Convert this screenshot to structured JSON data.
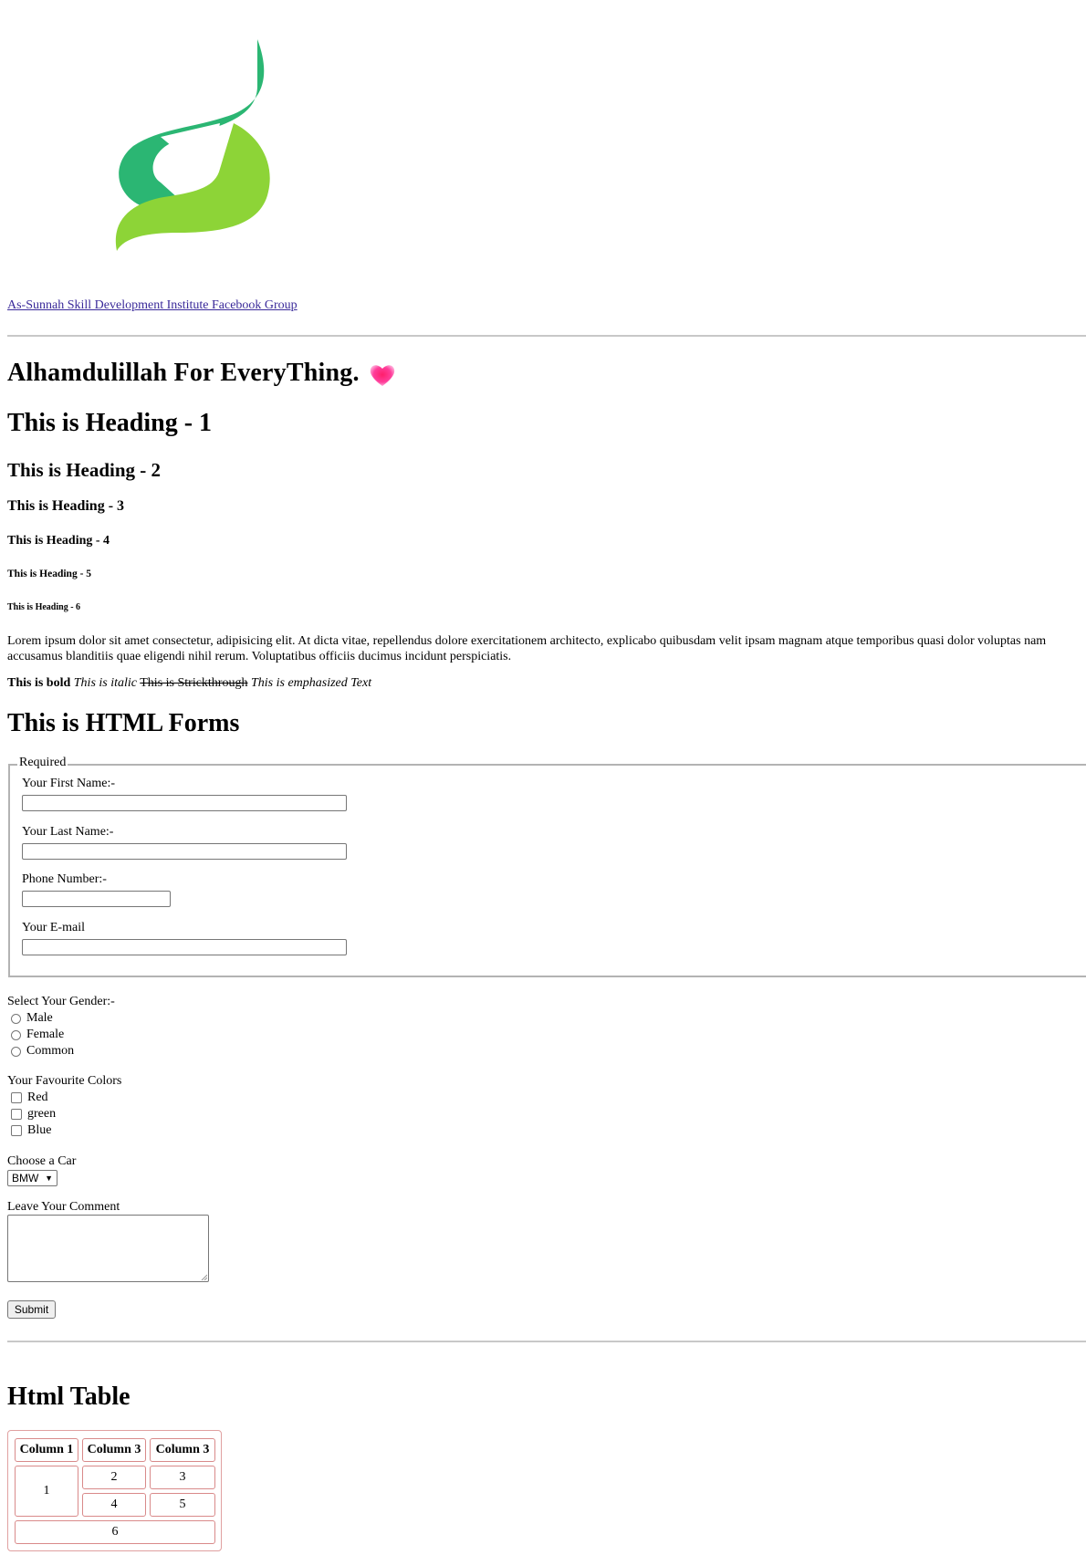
{
  "link": {
    "text": "As-Sunnah Skill Development Institute Facebook Group"
  },
  "headings": {
    "main": "Alhamdulillah For EveryThing.",
    "h1": "This is Heading - 1",
    "h2": "This is Heading - 2",
    "h3": "This is Heading - 3",
    "h4": "This is Heading - 4",
    "h5": "This is Heading - 5",
    "h6": "This is Heading - 6"
  },
  "paragraph": "Lorem ipsum dolor sit amet consectetur, adipisicing elit. At dicta vitae, repellendus dolore exercitationem architecto, explicabo quibusdam velit ipsam magnam atque temporibus quasi dolor voluptas nam accusamus blanditiis quae eligendi nihil rerum. Voluptatibus officiis ducimus incidunt perspiciatis.",
  "formatting": {
    "bold": "This is bold",
    "italic": "This is italic",
    "strike": "This is Strickthrough",
    "emphasized": "This is emphasized Text"
  },
  "forms": {
    "title": "This is HTML Forms",
    "legend": "Required",
    "first_name_label": "Your First Name:-",
    "first_name_value": "",
    "last_name_label": "Your Last Name:-",
    "last_name_value": "",
    "phone_label": "Phone Number:-",
    "phone_value": "",
    "email_label": "Your E-mail",
    "email_value": "",
    "gender_label": "Select Your Gender:-",
    "genders": [
      "Male",
      "Female",
      "Common"
    ],
    "colors_label": "Your Favourite Colors",
    "colors": [
      "Red",
      "green",
      "Blue"
    ],
    "car_label": "Choose a Car",
    "car_selected": "BMW",
    "comment_label": "Leave Your Comment",
    "comment_value": "",
    "submit_label": "Submit"
  },
  "table": {
    "title": "Html Table",
    "headers": [
      "Column 1",
      "Column 3",
      "Column 3"
    ],
    "cells": [
      "1",
      "2",
      "3",
      "4",
      "5",
      "6"
    ]
  },
  "colors": {
    "logo_dark_green": "#2bb673",
    "logo_light_green": "#8dd437",
    "heart": "#ff2d8f",
    "link": "#3a2a9a",
    "table_border": "#d98a8a"
  }
}
